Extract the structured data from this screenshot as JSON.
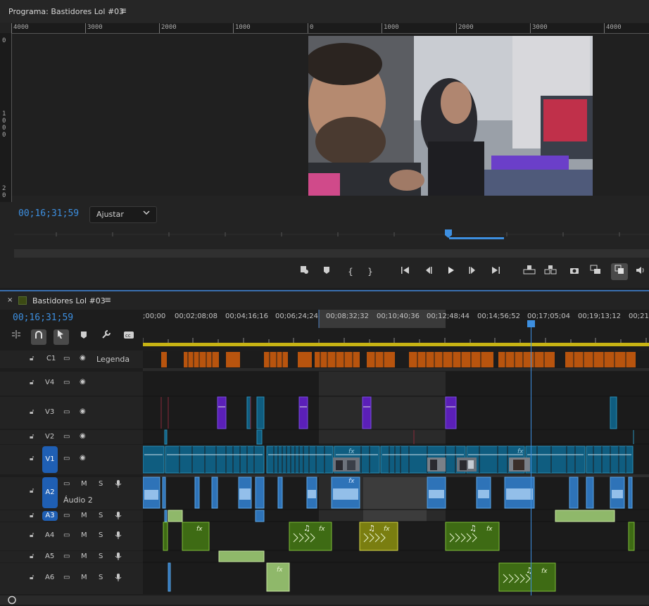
{
  "program": {
    "title": "Programa: Bastidores Lol #03",
    "menu_icon": "≡",
    "ruler_labels": [
      "4000",
      "3000",
      "2000",
      "1000",
      "0",
      "1000",
      "2000",
      "3000",
      "4000"
    ],
    "vruler_labels": [
      "0",
      "1\n0\n0\n0",
      "2\n0"
    ],
    "timecode": "00;16;31;59",
    "fit": {
      "label": "Ajustar",
      "icon": "chevron-down-icon"
    },
    "transport": [
      "marker-icon",
      "in-point-icon",
      "out-point-icon",
      "go-to-in-icon",
      "step-back-icon",
      "play-icon",
      "step-forward-icon",
      "go-to-out-icon",
      "lift-icon",
      "extract-icon",
      "export-frame-icon",
      "comparison-view-icon",
      "toggle-proxies-icon",
      "volume-icon"
    ]
  },
  "sequence": {
    "tab_title": "Bastidores Lol #03",
    "menu_icon": "≡",
    "close": "×",
    "timecode": "00;16;31;59",
    "ruler_labels": [
      ";00;00",
      "00;02;08;08",
      "00;04;16;16",
      "00;06;24;24",
      "00;08;32;32",
      "00;10;40;36",
      "00;12;48;44",
      "00;14;56;52",
      "00;17;05;04",
      "00;19;13;12",
      "00;21;"
    ],
    "tracks": [
      {
        "id": "C1",
        "label": "Legenda",
        "kind": "caption"
      },
      {
        "id": "V4",
        "kind": "video"
      },
      {
        "id": "V3",
        "kind": "video"
      },
      {
        "id": "V2",
        "kind": "video"
      },
      {
        "id": "V1",
        "kind": "video",
        "selected": true
      },
      {
        "id": "A2",
        "kind": "audio",
        "selected": true,
        "sub": "Áudio 2"
      },
      {
        "id": "A3",
        "kind": "audio",
        "selected": true
      },
      {
        "id": "A4",
        "kind": "audio"
      },
      {
        "id": "A5",
        "kind": "audio"
      },
      {
        "id": "A6",
        "kind": "audio"
      }
    ],
    "m_label": "M",
    "s_label": "S",
    "fx_label": "fx"
  },
  "colors": {
    "accent": "#3d8fe0",
    "video_clip": "#0f5d80",
    "audio_clip": "#2e73b8",
    "purple_clip": "#5b1fb8",
    "green_clip": "#3e6b14",
    "caption": "#b8540e"
  }
}
